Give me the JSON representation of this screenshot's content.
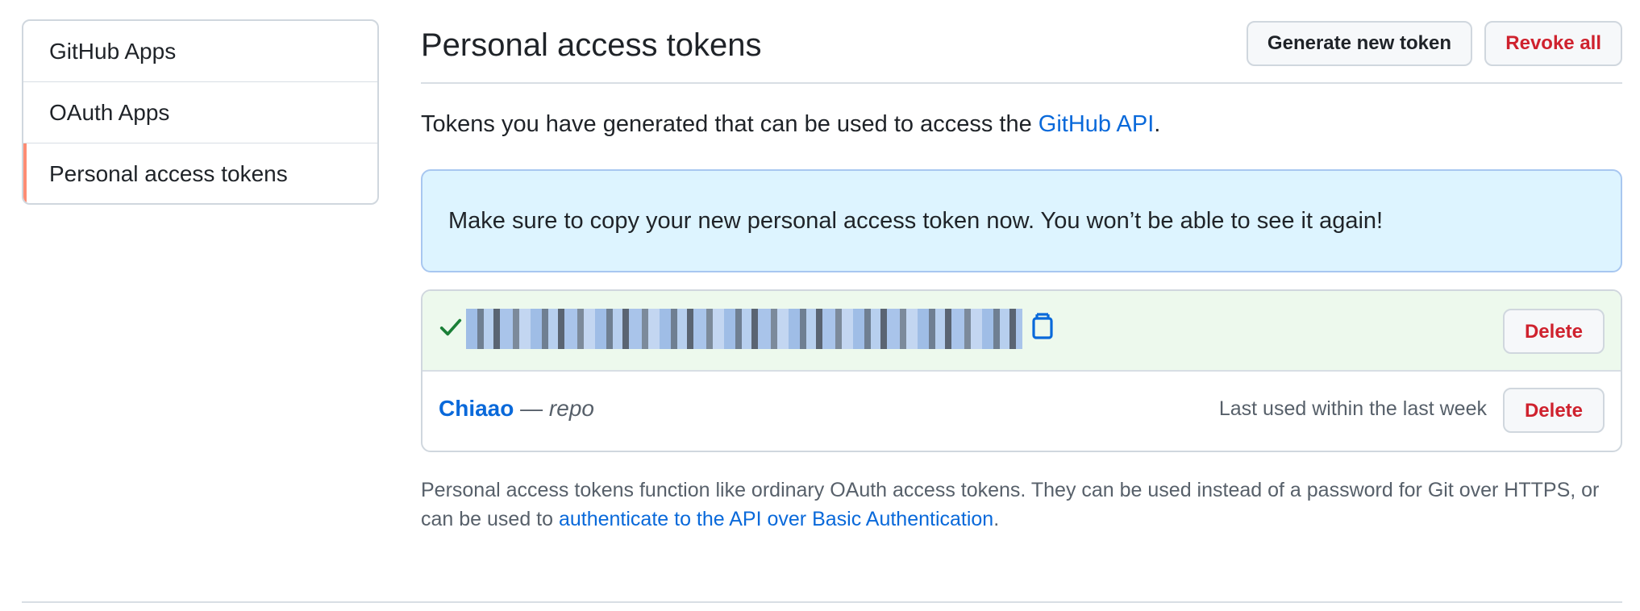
{
  "sidebar": {
    "items": [
      {
        "label": "GitHub Apps",
        "selected": false
      },
      {
        "label": "OAuth Apps",
        "selected": false
      },
      {
        "label": "Personal access tokens",
        "selected": true
      }
    ],
    "selected_accent": "#fd8c73"
  },
  "header": {
    "title": "Personal access tokens",
    "generate_label": "Generate new token",
    "revoke_label": "Revoke all"
  },
  "intro": {
    "text": "Tokens you have generated that can be used to access the ",
    "link_text": "GitHub API",
    "suffix": "."
  },
  "flash": {
    "message": "Make sure to copy your new personal access token now. You won’t be able to see it again!"
  },
  "tokens": {
    "new_token": {
      "value": "",
      "delete_label": "Delete",
      "icons": [
        "check-icon",
        "copy-icon"
      ]
    },
    "existing_token": {
      "name": "Chiaao",
      "separator": " — ",
      "scope": "repo",
      "last_used": "Last used within the last week",
      "delete_label": "Delete"
    }
  },
  "footer": {
    "text": "Personal access tokens function like ordinary OAuth access tokens. They can be used instead of a password for Git over HTTPS, or can be used to ",
    "link_text": "authenticate to the API over Basic Authentication",
    "suffix": "."
  },
  "colors": {
    "link": "#0969da",
    "danger": "#cf222e",
    "flash_bg": "#ddf4ff",
    "success_bg": "#edf9ed",
    "success_icon": "#1a7f37"
  }
}
